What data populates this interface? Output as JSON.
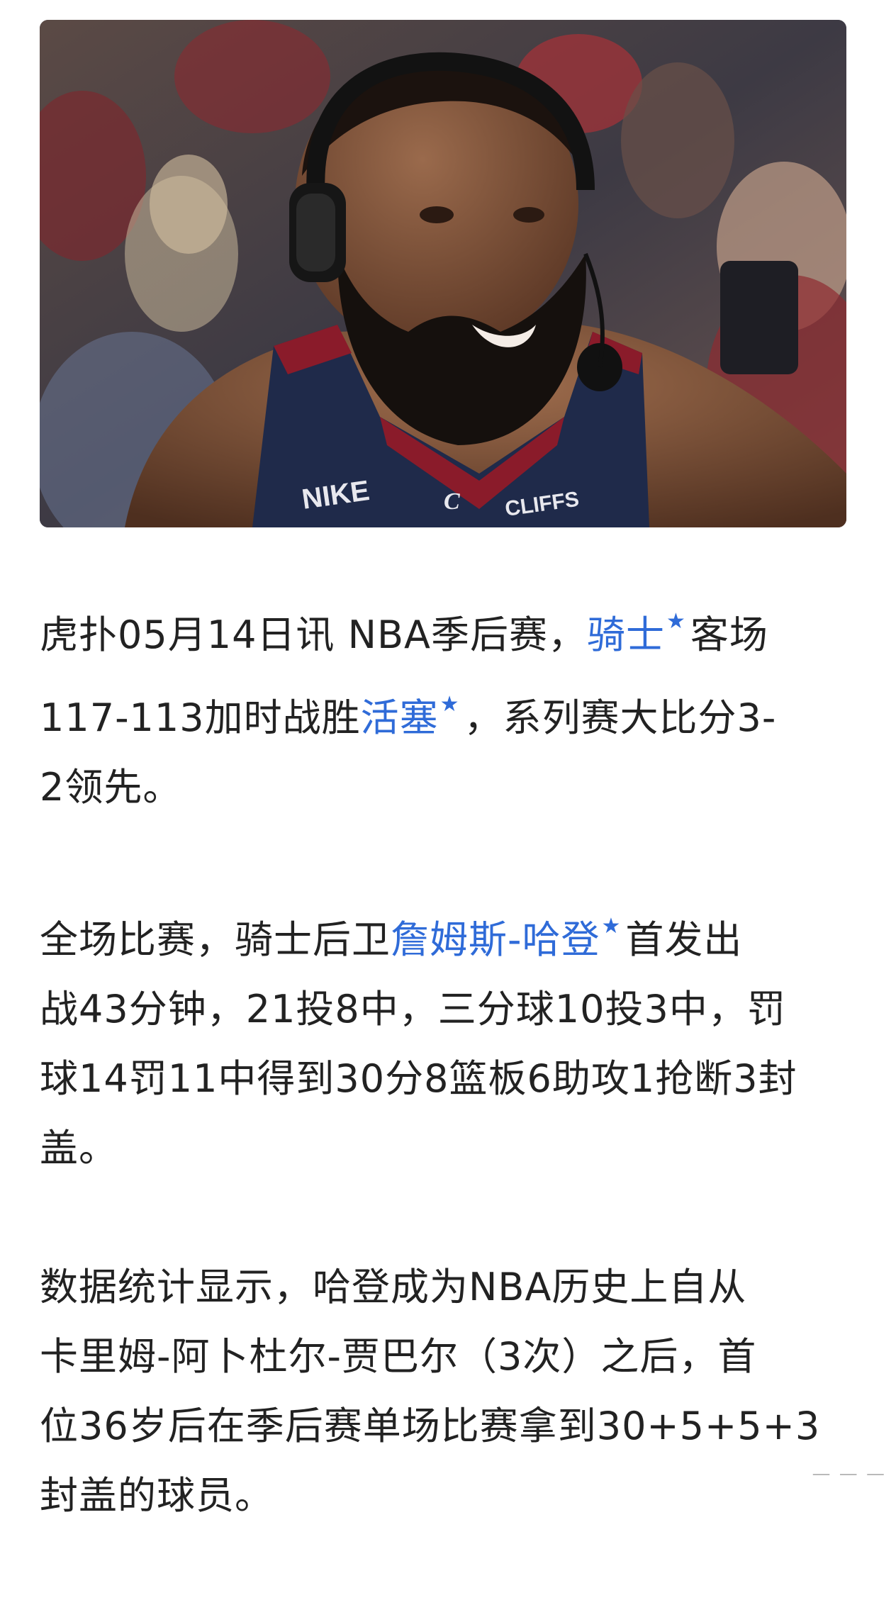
{
  "photo": {
    "jersey_brand": "NIKE",
    "jersey_sponsor": "CLIFFS",
    "jersey_logo": "C"
  },
  "paragraphs": [
    {
      "lines": [
        [
          {
            "t": "虎扑05月14日讯 NBA季后赛，"
          },
          {
            "t": "骑士",
            "link": true
          },
          {
            "t": "客场"
          }
        ],
        [
          {
            "t": "117-113加时战胜"
          },
          {
            "t": "活塞",
            "link": true
          },
          {
            "t": "，系列赛大比分3-"
          }
        ],
        [
          {
            "t": "2领先。"
          }
        ]
      ]
    },
    {
      "lines": [
        [
          {
            "t": "全场比赛，骑士后卫"
          },
          {
            "t": "詹姆斯-哈登",
            "link": true
          },
          {
            "t": "首发出"
          }
        ],
        [
          {
            "t": "战43分钟，21投8中，三分球10投3中，罚"
          }
        ],
        [
          {
            "t": "球14罚11中得到30分8篮板6助攻1抢断3封"
          }
        ],
        [
          {
            "t": "盖。"
          }
        ]
      ]
    },
    {
      "lines": [
        [
          {
            "t": "数据统计显示，哈登成为NBA历史上自从"
          }
        ],
        [
          {
            "t": "卡里姆-阿卜杜尔-贾巴尔（3次）之后，首"
          }
        ],
        [
          {
            "t": "位36岁后在季后赛单场比赛拿到30+5+5+3"
          }
        ],
        [
          {
            "t": "封盖的球员。"
          }
        ]
      ]
    }
  ],
  "link_star_glyph": "★",
  "colors": {
    "text": "#222222",
    "link": "#2f6bd8",
    "background": "#ffffff"
  },
  "watermark": "— — —"
}
